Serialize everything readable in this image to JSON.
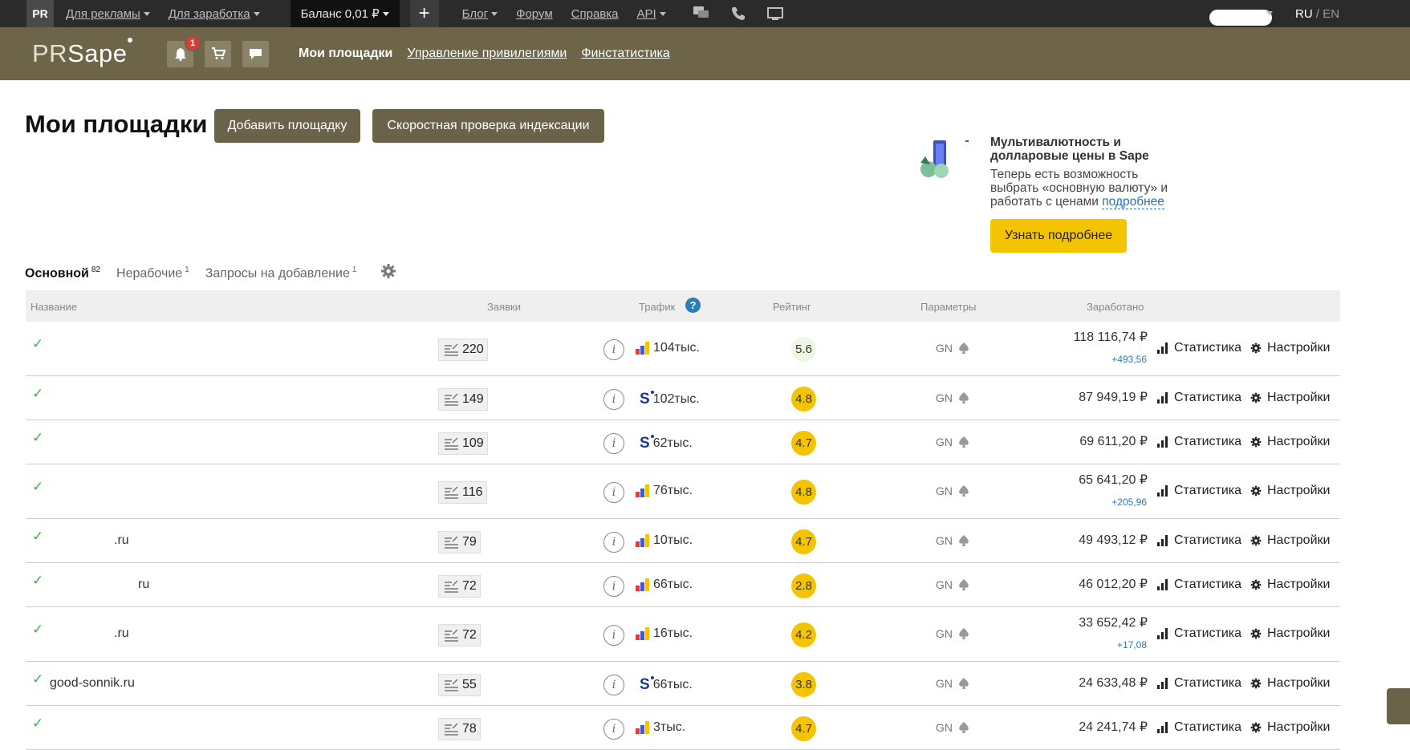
{
  "topbar": {
    "pr_tab": "PR",
    "for_ads": "Для рекламы",
    "for_earn": "Для заработка",
    "balance": "Баланс 0,01 ₽",
    "plus": "+",
    "blog": "Блог",
    "forum": "Форум",
    "help": "Справка",
    "api": "API",
    "lang_ru": "RU",
    "lang_sep": " / ",
    "lang_en": "EN"
  },
  "header": {
    "logo_pr": "PR",
    "logo_sape": "Sape",
    "notif_count": "1",
    "nav": [
      "Мои площадки",
      "Управление привилегиями",
      "Финстатистика"
    ]
  },
  "page": {
    "title": "Мои площадки",
    "add_button": "Добавить площадку",
    "index_check_button": "Скоростная проверка индексации"
  },
  "promo": {
    "title": "Мультивалютность и долларовые цены в Sape",
    "text": "Теперь есть возможность выбрать «основную валюту» и работать с ценами ",
    "link": "подробнее",
    "button": "Узнать подробнее"
  },
  "tabs": [
    {
      "label": "Основной",
      "count": "82"
    },
    {
      "label": "Нерабочие",
      "count": "1"
    },
    {
      "label": "Запросы на добавление",
      "count": "1"
    }
  ],
  "table": {
    "headers": {
      "name": "Название",
      "requests": "Заявки",
      "traffic": "Трафик",
      "rating": "Рейтинг",
      "params": "Параметры",
      "earned": "Заработано"
    },
    "stat_label": "Статистика",
    "settings_label": "Настройки",
    "rows": [
      {
        "name": "",
        "requests": "220",
        "source": "ya",
        "traffic": "104тыс.",
        "rating": "5.6",
        "params": "GN",
        "earned": "118 116,74 ₽",
        "delta": "+493,56"
      },
      {
        "name": "",
        "requests": "149",
        "source": "s",
        "traffic": "102тыс.",
        "rating": "4.8",
        "params": "GN",
        "earned": "87 949,19 ₽",
        "delta": ""
      },
      {
        "name": "",
        "requests": "109",
        "source": "s",
        "traffic": "62тыс.",
        "rating": "4.7",
        "params": "GN",
        "earned": "69 611,20 ₽",
        "delta": ""
      },
      {
        "name": "",
        "requests": "116",
        "source": "ya",
        "traffic": "76тыс.",
        "rating": "4.8",
        "params": "GN",
        "earned": "65 641,20 ₽",
        "delta": "+205,96"
      },
      {
        "name": ".ru",
        "requests": "79",
        "source": "ya",
        "traffic": "10тыс.",
        "rating": "4.7",
        "params": "GN",
        "earned": "49 493,12 ₽",
        "delta": ""
      },
      {
        "name": "ru",
        "requests": "72",
        "source": "ya",
        "traffic": "66тыс.",
        "rating": "2.8",
        "params": "GN",
        "earned": "46 012,20 ₽",
        "delta": ""
      },
      {
        "name": ".ru",
        "requests": "72",
        "source": "ya",
        "traffic": "16тыс.",
        "rating": "4.2",
        "params": "GN",
        "earned": "33 652,42 ₽",
        "delta": "+17,08"
      },
      {
        "name": "good-sonnik.ru",
        "requests": "55",
        "source": "s",
        "traffic": "66тыс.",
        "rating": "3.8",
        "params": "GN",
        "earned": "24 633,48 ₽",
        "delta": ""
      },
      {
        "name": "",
        "requests": "78",
        "source": "ya",
        "traffic": "3тыс.",
        "rating": "4.7",
        "params": "GN",
        "earned": "24 241,74 ₽",
        "delta": ""
      }
    ]
  }
}
